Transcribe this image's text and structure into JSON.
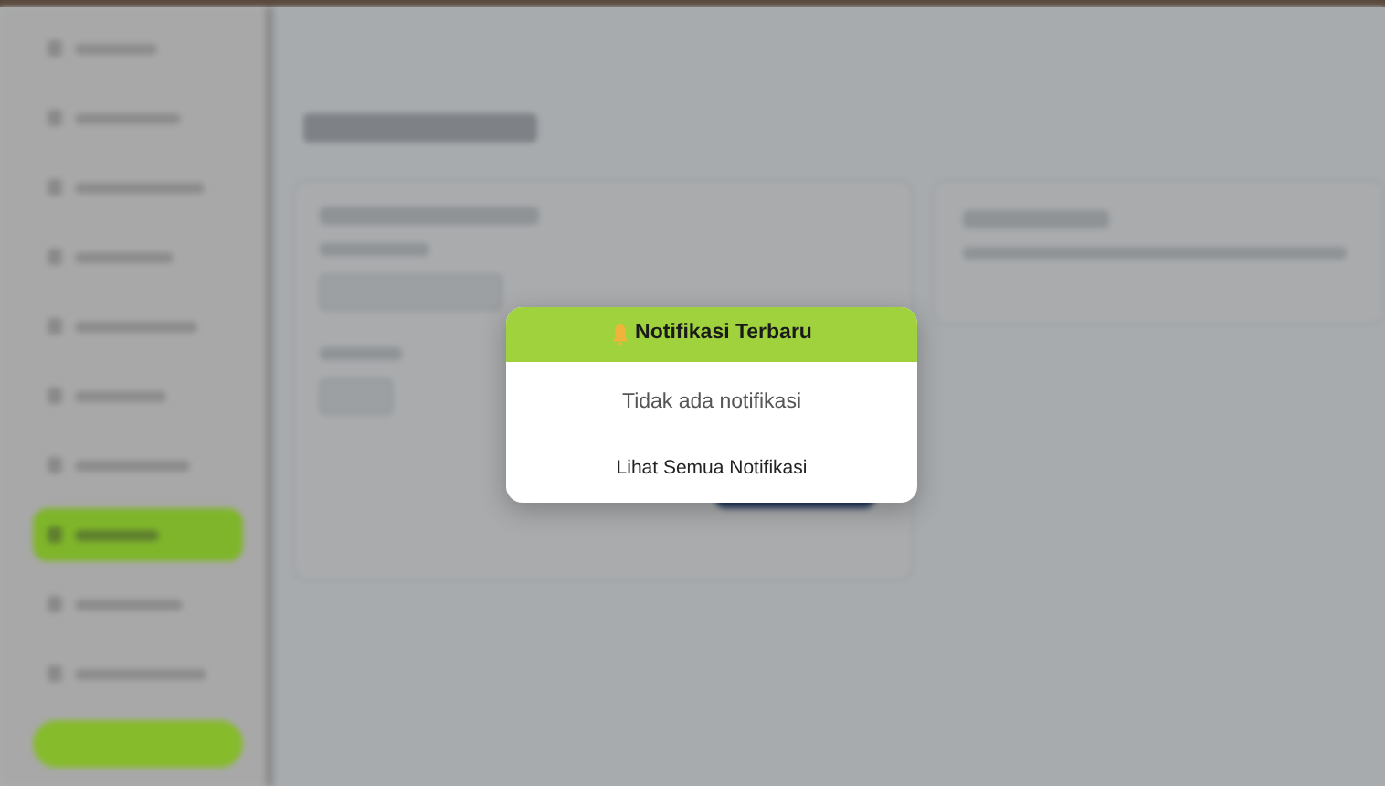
{
  "sidebar": {
    "items": [
      {
        "selected": false
      },
      {
        "selected": false
      },
      {
        "selected": false
      },
      {
        "selected": false
      },
      {
        "selected": false
      },
      {
        "selected": false
      },
      {
        "selected": false
      },
      {
        "selected": true
      },
      {
        "selected": false
      },
      {
        "selected": false
      }
    ]
  },
  "notification_popup": {
    "title": "Notifikasi Terbaru",
    "message": "Tidak ada notifikasi",
    "link": "Lihat Semua Notifikasi"
  }
}
